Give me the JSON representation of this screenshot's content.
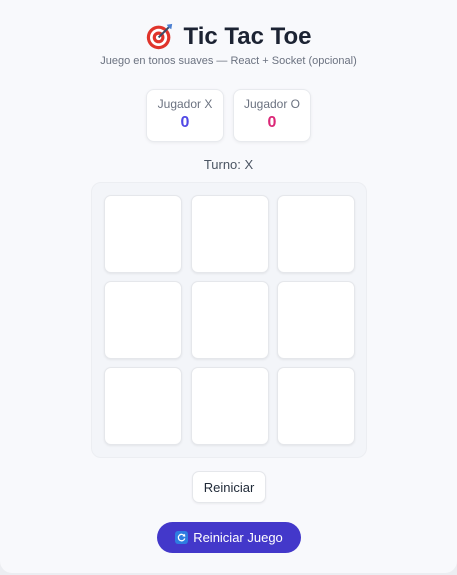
{
  "header": {
    "title": "Tic Tac Toe",
    "title_icon": "target-icon",
    "subtitle": "Juego en tonos suaves — React + Socket (opcional)"
  },
  "scores": {
    "x": {
      "label": "Jugador X",
      "value": "0",
      "color": "#5048e5"
    },
    "o": {
      "label": "Jugador O",
      "value": "0",
      "color": "#db2777"
    }
  },
  "turn": "Turno: X",
  "board": {
    "cells": [
      "",
      "",
      "",
      "",
      "",
      "",
      "",
      "",
      ""
    ]
  },
  "buttons": {
    "reset": "Reiniciar",
    "reset_game": "Reiniciar Juego",
    "reset_game_icon": "refresh-icon"
  },
  "colors": {
    "accent": "#4338ca",
    "title": "#1c2333",
    "background": "#f8f9fc"
  }
}
